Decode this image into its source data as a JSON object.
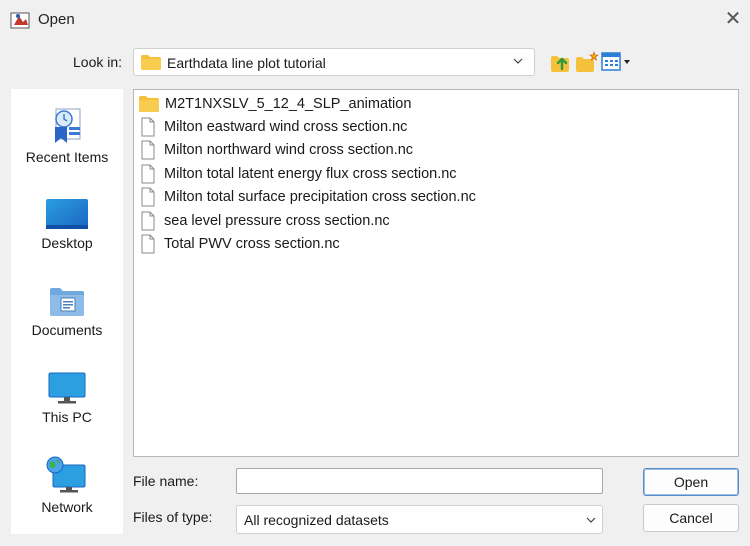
{
  "window": {
    "title": "Open",
    "close_glyph": "✕"
  },
  "look_in": {
    "label": "Look in:",
    "value": "Earthdata line plot tutorial",
    "icon": "folder-icon"
  },
  "toolbar": {
    "icons": [
      "up-one-level-icon",
      "new-folder-icon",
      "view-menu-icon"
    ]
  },
  "places": [
    {
      "label": "Recent Items",
      "icon": "recent-items-icon"
    },
    {
      "label": "Desktop",
      "icon": "desktop-icon"
    },
    {
      "label": "Documents",
      "icon": "documents-icon"
    },
    {
      "label": "This PC",
      "icon": "this-pc-icon"
    },
    {
      "label": "Network",
      "icon": "network-icon"
    }
  ],
  "files": [
    {
      "name": "M2T1NXSLV_5_12_4_SLP_animation",
      "type": "folder"
    },
    {
      "name": "Milton eastward wind cross section.nc",
      "type": "file"
    },
    {
      "name": "Milton northward wind cross section.nc",
      "type": "file"
    },
    {
      "name": "Milton total latent energy flux cross section.nc",
      "type": "file"
    },
    {
      "name": "Milton total surface precipitation cross section.nc",
      "type": "file"
    },
    {
      "name": "sea level pressure cross section.nc",
      "type": "file"
    },
    {
      "name": "Total PWV cross section.nc",
      "type": "file"
    }
  ],
  "file_name": {
    "label": "File name:",
    "value": ""
  },
  "file_type": {
    "label": "Files of type:",
    "value": "All recognized datasets"
  },
  "buttons": {
    "open": "Open",
    "cancel": "Cancel"
  },
  "colors": {
    "folder": "#f5c03a",
    "accent_blue": "#2a7fd6",
    "background": "#f0f0f0"
  }
}
